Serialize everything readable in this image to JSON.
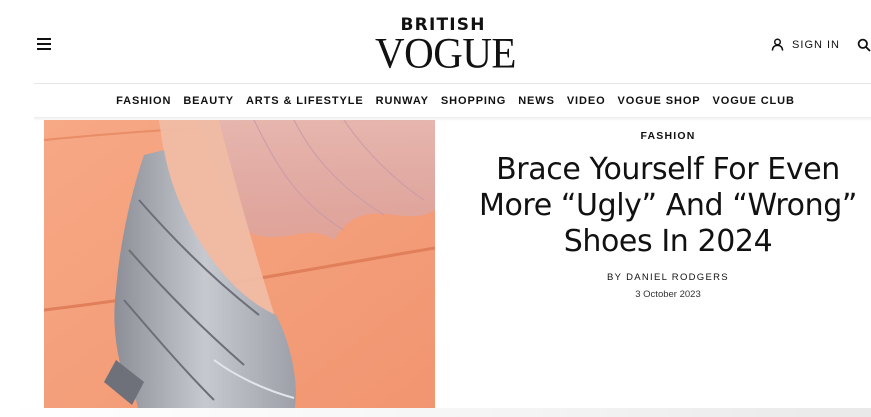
{
  "brand": {
    "small": "BRITISH",
    "main": "VOGUE"
  },
  "header": {
    "signin_label": "SIGN IN",
    "menu_icon": "hamburger-menu-icon",
    "user_icon": "user-icon",
    "search_icon": "search-icon"
  },
  "nav": {
    "items": [
      "FASHION",
      "BEAUTY",
      "ARTS & LIFESTYLE",
      "RUNWAY",
      "SHOPPING",
      "NEWS",
      "VIDEO",
      "VOGUE SHOP",
      "VOGUE CLUB"
    ]
  },
  "article": {
    "category": "FASHION",
    "headline": "Brace Yourself For Even More “Ugly” And “Wrong” Shoes In 2024",
    "byline": "BY DANIEL RODGERS",
    "date": "3 October 2023"
  },
  "colors": {
    "hero_background": "#f4a07c",
    "text": "#111111"
  }
}
